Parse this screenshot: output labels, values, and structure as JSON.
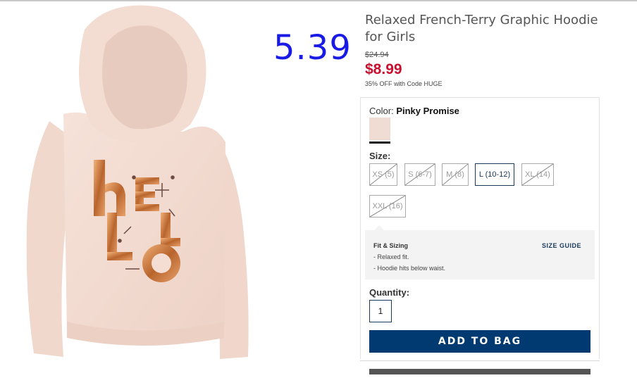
{
  "overlay": {
    "price_text": "5.39"
  },
  "product": {
    "title": "Relaxed French-Terry Graphic Hoodie for Girls",
    "original_price": "$24.94",
    "sale_price": "$8.99",
    "promo": "35% OFF with Code HUGE",
    "graphic_text": "hello"
  },
  "color": {
    "label": "Color:",
    "value": "Pinky Promise",
    "swatch_color": "#efdcd3"
  },
  "size": {
    "label": "Size:",
    "options": [
      {
        "label": "XS (5)",
        "available": false
      },
      {
        "label": "S (6-7)",
        "available": false
      },
      {
        "label": "M (8)",
        "available": false
      },
      {
        "label": "L (10-12)",
        "available": true,
        "selected": true
      },
      {
        "label": "XL (14)",
        "available": false
      },
      {
        "label": "XXL (16)",
        "available": false
      }
    ]
  },
  "fit": {
    "title": "Fit & Sizing",
    "guide_link": "SIZE GUIDE",
    "lines": [
      "- Relaxed fit.",
      "- Hoodie hits below waist."
    ]
  },
  "quantity": {
    "label": "Quantity:",
    "value": "1"
  },
  "actions": {
    "add_to_bag": "ADD TO BAG"
  },
  "colors": {
    "accent": "#003a70",
    "sale": "#c8102e",
    "overlay": "#1a1ae6"
  }
}
